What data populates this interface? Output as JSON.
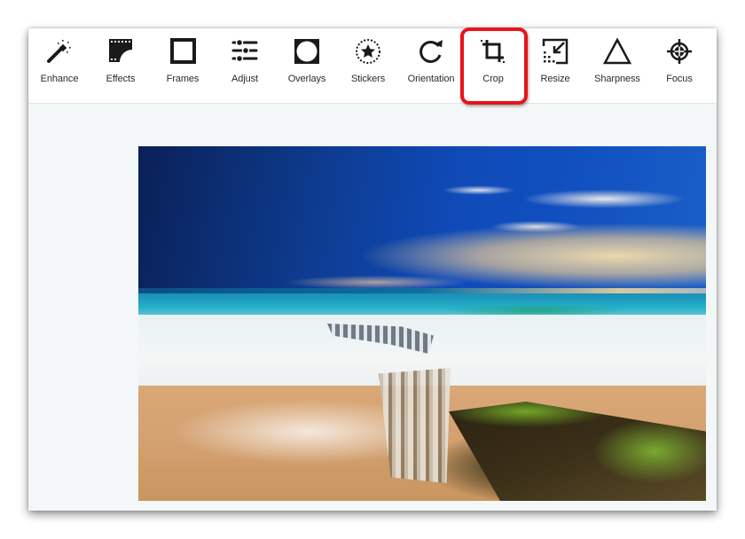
{
  "toolbar": {
    "tools": [
      {
        "id": "enhance",
        "label": "Enhance",
        "icon": "magic-wand-icon"
      },
      {
        "id": "effects",
        "label": "Effects",
        "icon": "film-strip-icon"
      },
      {
        "id": "frames",
        "label": "Frames",
        "icon": "square-frame-icon"
      },
      {
        "id": "adjust",
        "label": "Adjust",
        "icon": "sliders-icon"
      },
      {
        "id": "overlays",
        "label": "Overlays",
        "icon": "overlay-circle-icon"
      },
      {
        "id": "stickers",
        "label": "Stickers",
        "icon": "star-sticker-icon"
      },
      {
        "id": "orientation",
        "label": "Orientation",
        "icon": "rotate-icon"
      },
      {
        "id": "crop",
        "label": "Crop",
        "icon": "crop-icon",
        "highlighted": true
      },
      {
        "id": "resize",
        "label": "Resize",
        "icon": "resize-icon"
      },
      {
        "id": "sharpness",
        "label": "Sharpness",
        "icon": "triangle-icon"
      },
      {
        "id": "focus",
        "label": "Focus",
        "icon": "crosshair-icon"
      }
    ],
    "highlight_color": "#e8141a"
  },
  "canvas": {
    "image_alt": "Beach photo: deep blue sky with clouds, turquoise sea, white surf flowing over a mossy rock shelf onto golden sand"
  }
}
